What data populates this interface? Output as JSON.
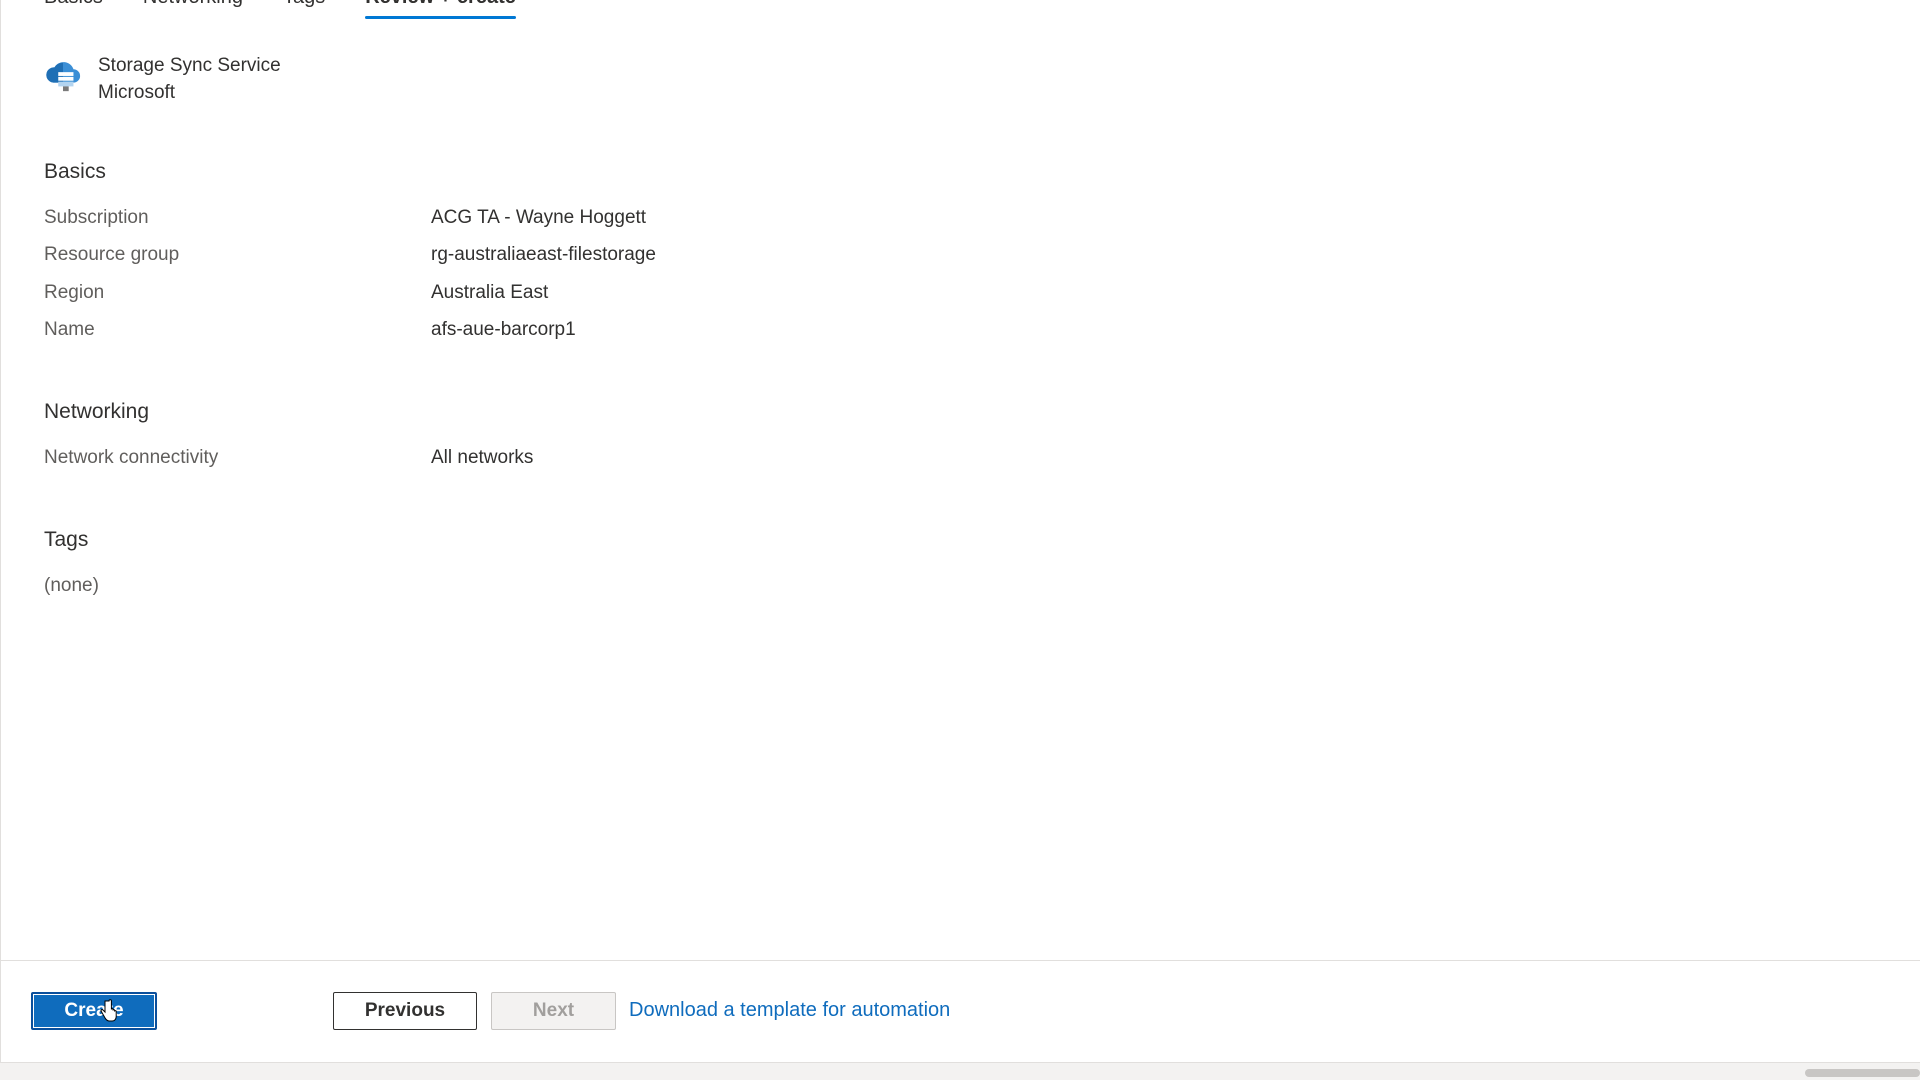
{
  "tabs": [
    {
      "label": "Basics"
    },
    {
      "label": "Networking"
    },
    {
      "label": "Tags"
    },
    {
      "label": "Review + create"
    }
  ],
  "resource": {
    "icon": "storage-sync-icon",
    "name": "Storage Sync Service",
    "publisher": "Microsoft"
  },
  "sections": {
    "basics": {
      "title": "Basics",
      "rows": [
        {
          "label": "Subscription",
          "value": "ACG TA - Wayne Hoggett"
        },
        {
          "label": "Resource group",
          "value": "rg-australiaeast-filestorage"
        },
        {
          "label": "Region",
          "value": "Australia East"
        },
        {
          "label": "Name",
          "value": "afs-aue-barcorp1"
        }
      ]
    },
    "networking": {
      "title": "Networking",
      "rows": [
        {
          "label": "Network connectivity",
          "value": "All networks"
        }
      ]
    },
    "tags": {
      "title": "Tags",
      "empty_text": "(none)"
    }
  },
  "footer": {
    "create_label": "Create",
    "previous_label": "Previous",
    "next_label": "Next",
    "download_link": "Download a template for automation"
  },
  "colors": {
    "accent": "#0f6cbd",
    "active_tab_underline": "#0078d4"
  }
}
